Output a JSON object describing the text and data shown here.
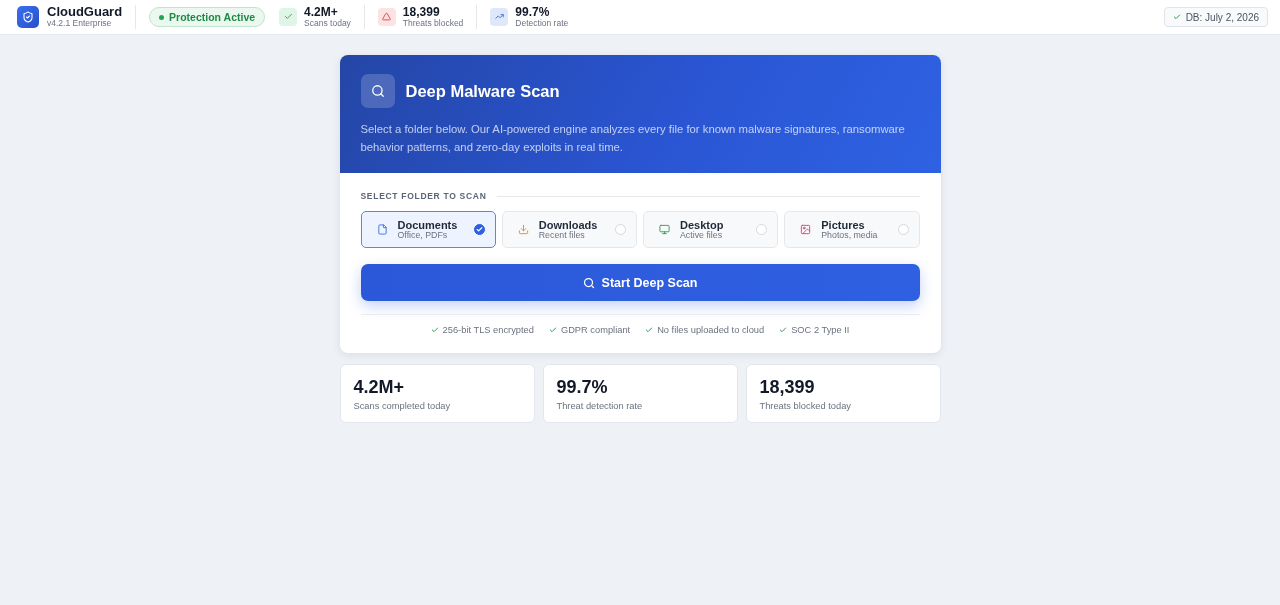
{
  "app": {
    "name": "CloudGuard",
    "version": "v4.2.1 Enterprise"
  },
  "status_badge": {
    "label": "Protection Active"
  },
  "header_stats": [
    {
      "kind": "success",
      "value": "4.2M+",
      "label": "Scans today"
    },
    {
      "kind": "danger",
      "value": "18,399",
      "label": "Threats blocked"
    },
    {
      "kind": "info",
      "value": "99.7%",
      "label": "Detection rate"
    }
  ],
  "db_badge": {
    "label": "DB: July 2, 2026"
  },
  "scan_card": {
    "title": "Deep Malware Scan",
    "description": "Select a folder below. Our AI-powered engine analyzes every file for known malware signatures, ransomware behavior patterns, and zero-day exploits in real time.",
    "section_label": "SELECT FOLDER TO SCAN",
    "folders": [
      {
        "kind": "documents",
        "name": "Documents",
        "subtitle": "Office, PDFs",
        "selected": true
      },
      {
        "kind": "downloads",
        "name": "Downloads",
        "subtitle": "Recent files",
        "selected": false
      },
      {
        "kind": "desktop",
        "name": "Desktop",
        "subtitle": "Active files",
        "selected": false
      },
      {
        "kind": "pictures",
        "name": "Pictures",
        "subtitle": "Photos, media",
        "selected": false
      }
    ],
    "button": "Start Deep Scan",
    "features": [
      "256-bit TLS encrypted",
      "GDPR compliant",
      "No files uploaded to cloud",
      "SOC 2 Type II"
    ]
  },
  "stats": [
    {
      "value": "4.2M+",
      "label": "Scans completed today"
    },
    {
      "value": "99.7%",
      "label": "Threat detection rate"
    },
    {
      "value": "18,399",
      "label": "Threats blocked today"
    }
  ]
}
